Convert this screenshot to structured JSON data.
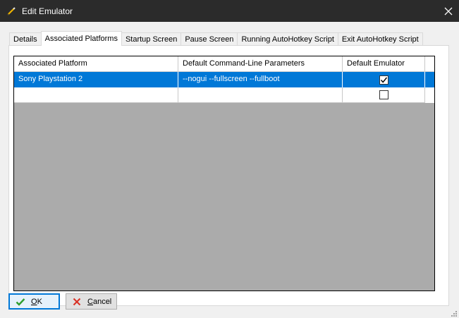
{
  "window": {
    "title": "Edit Emulator"
  },
  "tabs": [
    {
      "label": "Details"
    },
    {
      "label": "Associated Platforms"
    },
    {
      "label": "Startup Screen"
    },
    {
      "label": "Pause Screen"
    },
    {
      "label": "Running AutoHotkey Script"
    },
    {
      "label": "Exit AutoHotkey Script"
    }
  ],
  "active_tab": "Associated Platforms",
  "grid": {
    "columns": [
      {
        "label": "Associated Platform"
      },
      {
        "label": "Default Command-Line Parameters"
      },
      {
        "label": "Default Emulator"
      }
    ],
    "rows": [
      {
        "platform": "Sony Playstation 2",
        "params": "--nogui --fullscreen --fullboot",
        "default": true,
        "selected": true
      },
      {
        "platform": "",
        "params": "",
        "default": false,
        "selected": false
      }
    ]
  },
  "buttons": {
    "ok_prefix": "O",
    "ok_rest": "K",
    "cancel_prefix": "C",
    "cancel_rest": "ancel"
  },
  "icons": {
    "app": "pencil-icon",
    "close": "close-icon",
    "ok": "check-icon",
    "cancel": "x-icon"
  },
  "colors": {
    "titlebar": "#2b2b2b",
    "selection": "#0078d7",
    "grid_empty": "#ababab",
    "ok_check": "#2e9e2e",
    "cancel_x": "#d93025"
  }
}
